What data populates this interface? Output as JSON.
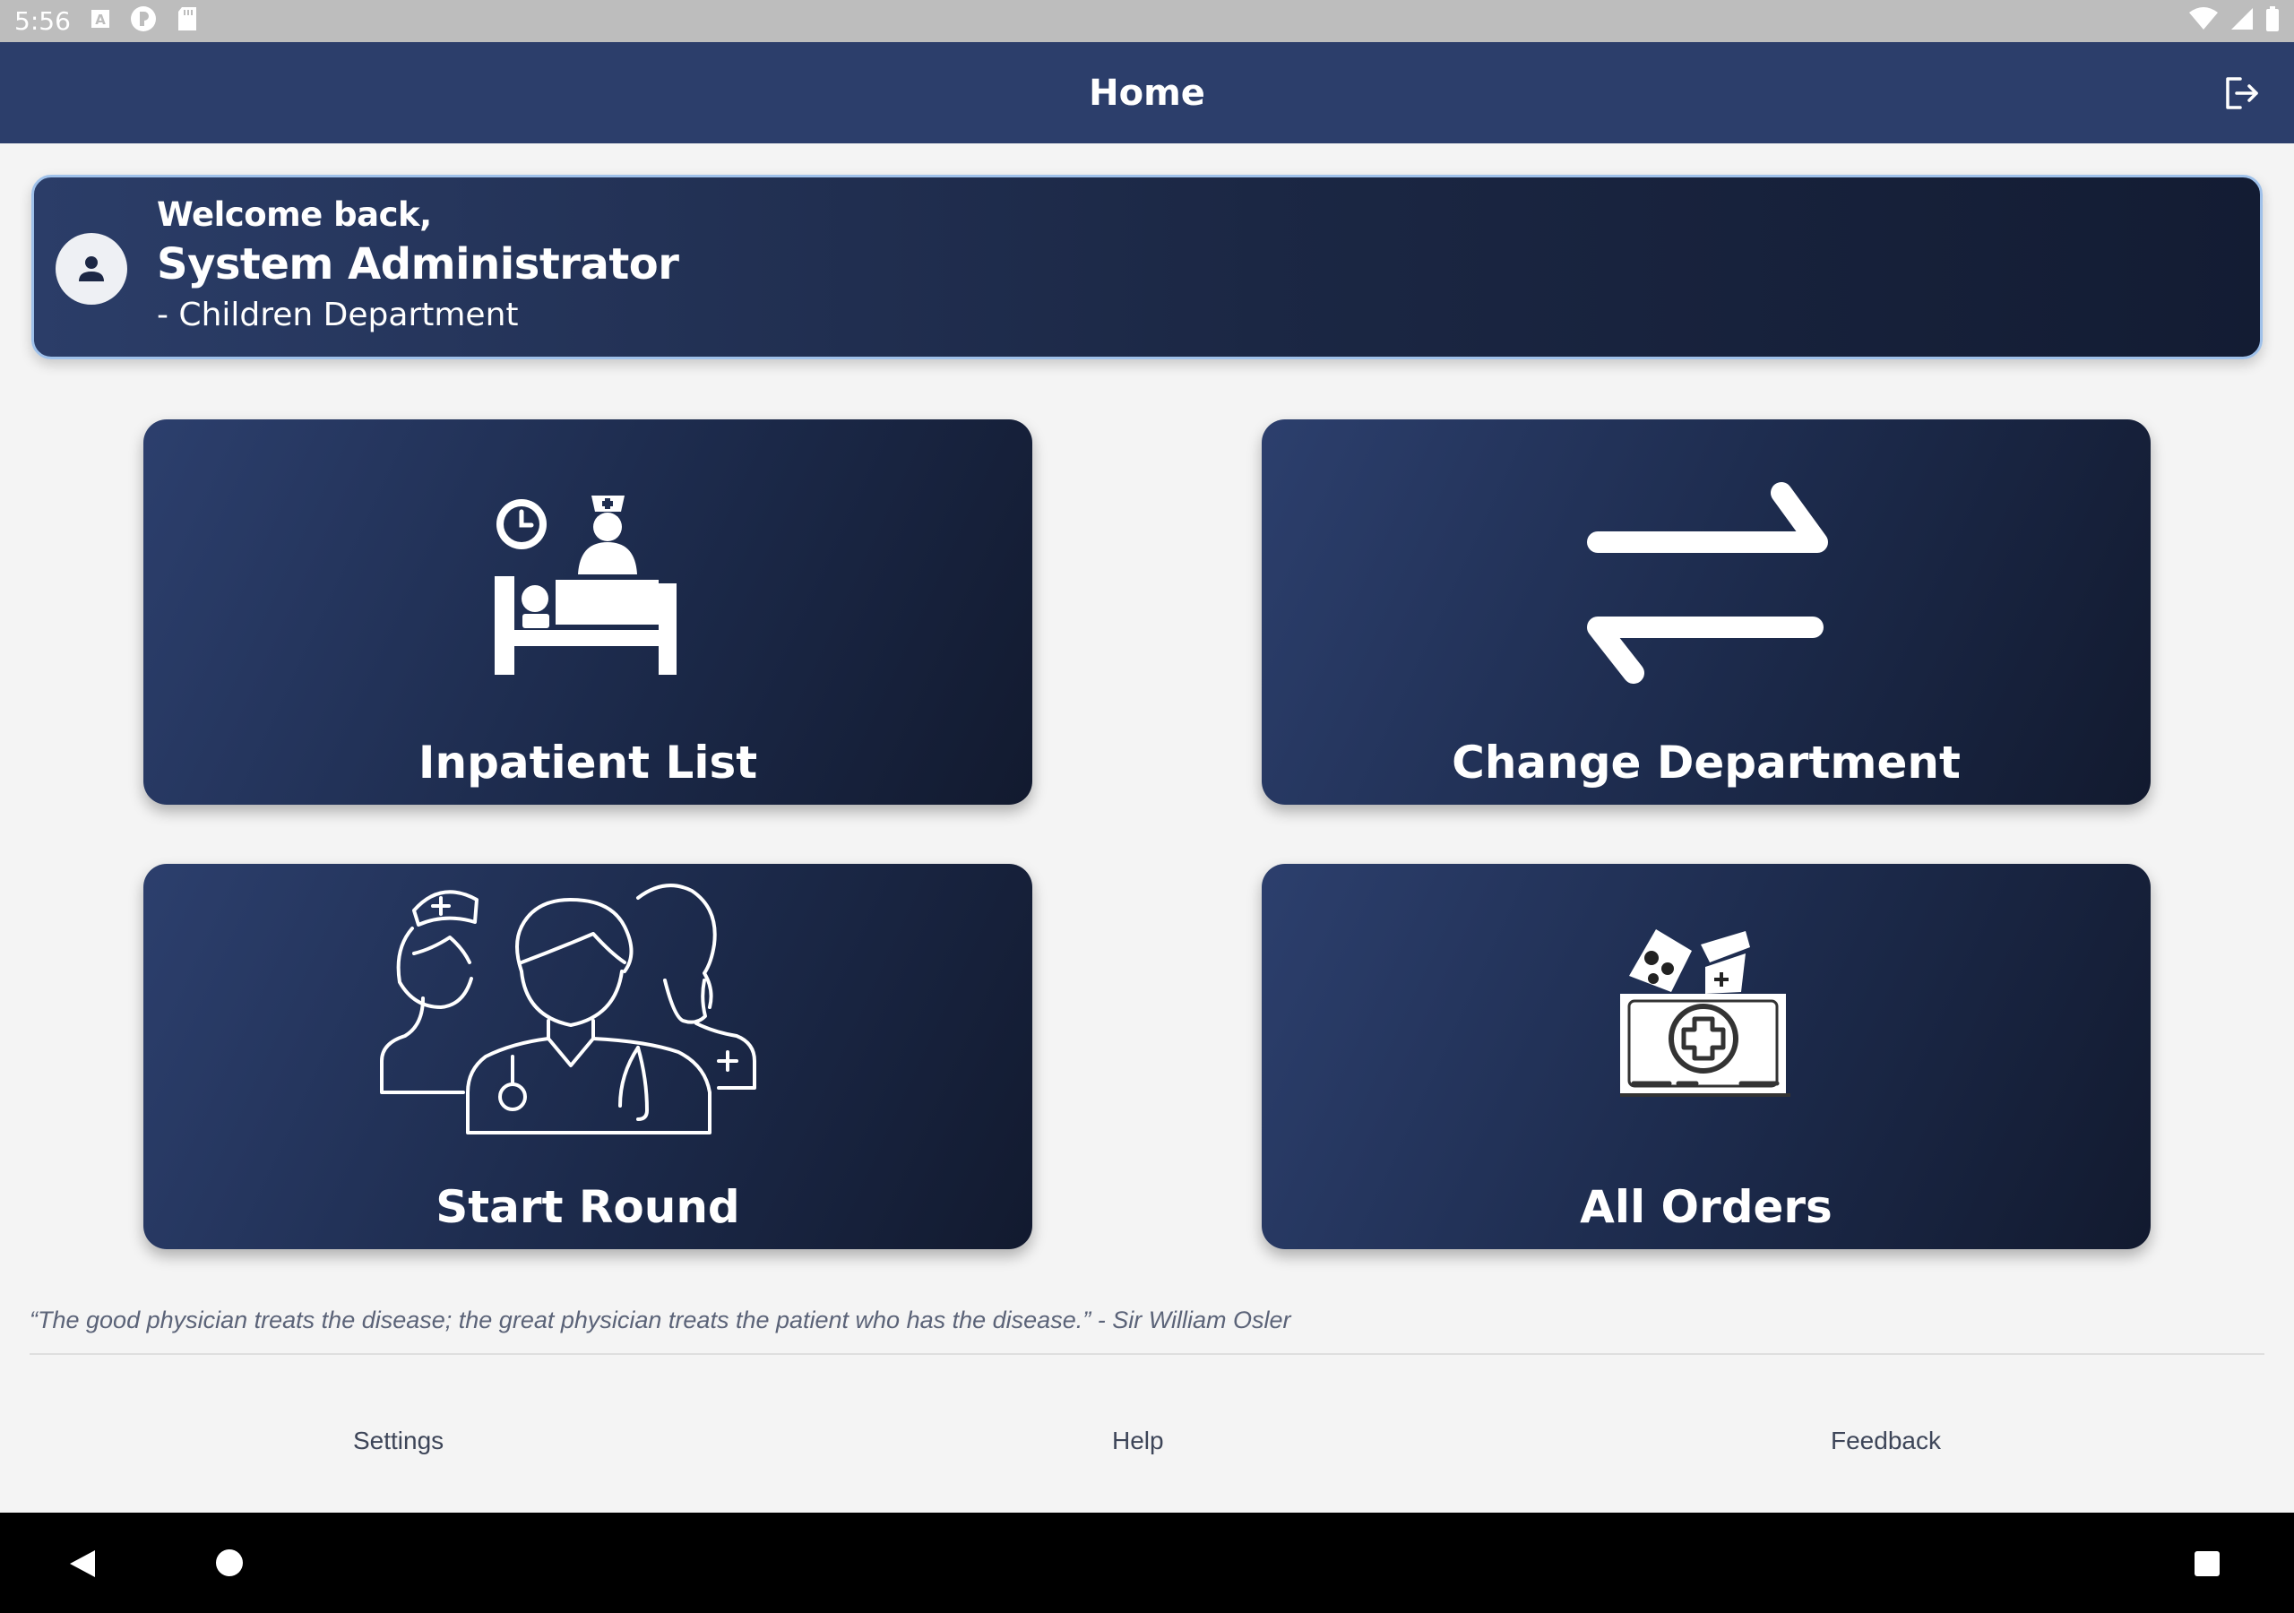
{
  "status_bar": {
    "time": "5:56",
    "icons_left": [
      "a-notification-icon",
      "p-app-icon",
      "sd-card-icon"
    ],
    "icons_right": [
      "wifi-icon",
      "signal-icon",
      "battery-icon"
    ]
  },
  "app_bar": {
    "title": "Home",
    "logout_icon": "logout-icon"
  },
  "welcome": {
    "greeting": "Welcome back,",
    "user_name": "System Administrator",
    "department": "- Children Department",
    "avatar_icon": "person-icon"
  },
  "tiles": [
    {
      "label": "Inpatient List",
      "icon": "hospital-bed-icon"
    },
    {
      "label": "Change Department",
      "icon": "swap-arrows-icon"
    },
    {
      "label": "Start Round",
      "icon": "medical-team-icon"
    },
    {
      "label": "All Orders",
      "icon": "medicine-bag-icon"
    }
  ],
  "quote": "“The good physician treats the disease; the great physician treats the patient who has the disease.” - Sir William Osler",
  "footer": {
    "settings": "Settings",
    "help": "Help",
    "feedback": "Feedback"
  },
  "colors": {
    "app_bar": "#2c3e6b",
    "tile_gradient_start": "#2c3f6d",
    "tile_gradient_end": "#121a2f",
    "welcome_border": "#9fc1ea",
    "background": "#f4f4f4"
  }
}
